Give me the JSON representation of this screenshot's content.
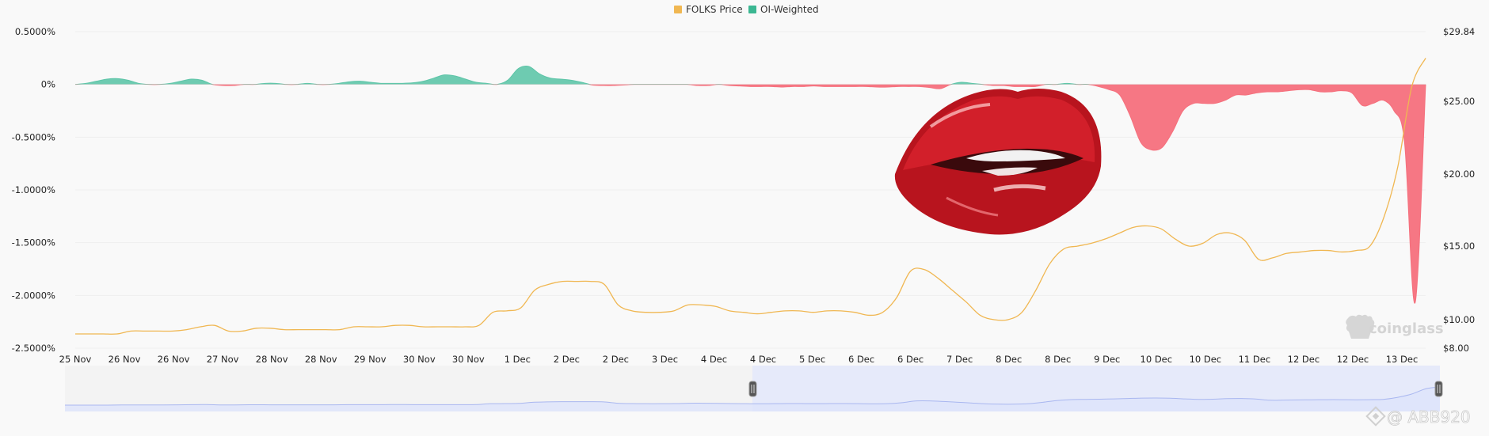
{
  "colors": {
    "price": "#f0b752",
    "oi_pos": "#5ec5a8",
    "oi_pos_legend": "#3bb792",
    "oi_neg": "#f5707d",
    "nav_line": "#a9b7f0",
    "nav_fill": "#dde3fb",
    "nav_selected": "#cfd8fa",
    "grid": "#eeeeee"
  },
  "legend": [
    {
      "name": "FOLKS Price",
      "color": "#f0b752"
    },
    {
      "name": "OI-Weighted",
      "color": "#3bb792"
    }
  ],
  "watermark": {
    "brand": "coinglass",
    "social": "@ ABB920",
    "icon": "coinglass-logo-icon"
  },
  "overlay": {
    "icon": "red-lips-icon"
  },
  "chart_data": {
    "type": "area",
    "x_categories": [
      "25 Nov",
      "26 Nov",
      "26 Nov",
      "27 Nov",
      "28 Nov",
      "28 Nov",
      "29 Nov",
      "30 Nov",
      "30 Nov",
      "1 Dec",
      "2 Dec",
      "2 Dec",
      "3 Dec",
      "4 Dec",
      "4 Dec",
      "5 Dec",
      "6 Dec",
      "6 Dec",
      "7 Dec",
      "8 Dec",
      "8 Dec",
      "9 Dec",
      "10 Dec",
      "10 Dec",
      "11 Dec",
      "12 Dec",
      "12 Dec",
      "13 Dec"
    ],
    "y_left": {
      "ticks": [
        "0.5000%",
        "0%",
        "-0.5000%",
        "-1.0000%",
        "-1.5000%",
        "-2.0000%",
        "-2.5000%"
      ],
      "range": [
        -2.5,
        0.5
      ]
    },
    "y_right": {
      "ticks": [
        "$29.84",
        "$25.00",
        "$20.00",
        "$15.00",
        "$10.00",
        "$8.00"
      ],
      "values": [
        29.84,
        25,
        20,
        15,
        10,
        8
      ]
    },
    "series": [
      {
        "name": "FOLKS Price",
        "type": "line",
        "values": [
          9.0,
          9.0,
          9.0,
          9.0,
          9.2,
          9.2,
          9.2,
          9.2,
          9.3,
          9.5,
          9.6,
          9.2,
          9.2,
          9.4,
          9.4,
          9.3,
          9.3,
          9.3,
          9.3,
          9.3,
          9.5,
          9.5,
          9.5,
          9.6,
          9.6,
          9.5,
          9.5,
          9.5,
          9.5,
          9.6,
          10.5,
          10.6,
          10.8,
          12.0,
          12.4,
          12.6,
          12.6,
          12.6,
          12.4,
          11.0,
          10.6,
          10.5,
          10.5,
          10.6,
          11.0,
          11.0,
          10.9,
          10.6,
          10.5,
          10.4,
          10.5,
          10.6,
          10.6,
          10.5,
          10.6,
          10.6,
          10.5,
          10.3,
          10.5,
          11.5,
          13.3,
          13.4,
          12.8,
          12.0,
          11.2,
          10.3,
          10.0,
          10.0,
          10.5,
          12.0,
          13.8,
          14.8,
          15.0,
          15.2,
          15.5,
          15.9,
          16.3,
          16.4,
          16.2,
          15.5,
          15.0,
          15.2,
          15.8,
          15.9,
          15.4,
          14.1,
          14.2,
          14.5,
          14.6,
          14.7,
          14.7,
          14.6,
          14.7,
          15.0,
          17.0,
          20.5,
          26.0,
          28.0
        ],
        "note": ""
      },
      {
        "name": "OI-Weighted",
        "type": "area",
        "values": [
          0.0,
          0.01,
          0.03,
          0.05,
          0.055,
          0.04,
          0.01,
          0.0,
          0.0,
          0.01,
          0.03,
          0.05,
          0.04,
          0.0,
          -0.01,
          -0.01,
          0.0,
          0.0,
          0.01,
          0.01,
          0.0,
          0.0,
          0.01,
          0.0,
          0.0,
          0.01,
          0.025,
          0.03,
          0.02,
          0.01,
          0.01,
          0.01,
          0.015,
          0.03,
          0.06,
          0.09,
          0.08,
          0.05,
          0.02,
          0.01,
          0.0,
          0.04,
          0.15,
          0.17,
          0.1,
          0.06,
          0.05,
          0.04,
          0.02,
          -0.005,
          -0.01,
          -0.01,
          -0.005,
          0.0,
          0.0,
          0.0,
          0.0,
          0.0,
          0.0,
          -0.01,
          -0.01,
          0.0,
          -0.01,
          -0.015,
          -0.02,
          -0.02,
          -0.02,
          -0.025,
          -0.02,
          -0.02,
          -0.015,
          -0.02,
          -0.02,
          -0.02,
          -0.02,
          -0.02,
          -0.025,
          -0.025,
          -0.02,
          -0.02,
          -0.02,
          -0.03,
          -0.04,
          0.0,
          0.02,
          0.01,
          0.0,
          -0.01,
          -0.01,
          -0.02,
          -0.02,
          -0.02,
          0.0,
          0.0,
          0.01,
          0.0,
          0.0,
          -0.02,
          -0.05,
          -0.1,
          -0.3,
          -0.55,
          -0.62,
          -0.6,
          -0.45,
          -0.25,
          -0.18,
          -0.18,
          -0.18,
          -0.15,
          -0.1,
          -0.1,
          -0.08,
          -0.07,
          -0.07,
          -0.06,
          -0.05,
          -0.05,
          -0.07,
          -0.07,
          -0.06,
          -0.08,
          -0.2,
          -0.18,
          -0.15,
          -0.25,
          -0.55,
          -2.07,
          0.0
        ]
      }
    ],
    "price_x_span": [
      0.0,
      1.0
    ],
    "oi_x_span": [
      0.0,
      1.0
    ],
    "legend_position": "top-center",
    "grid": true
  }
}
